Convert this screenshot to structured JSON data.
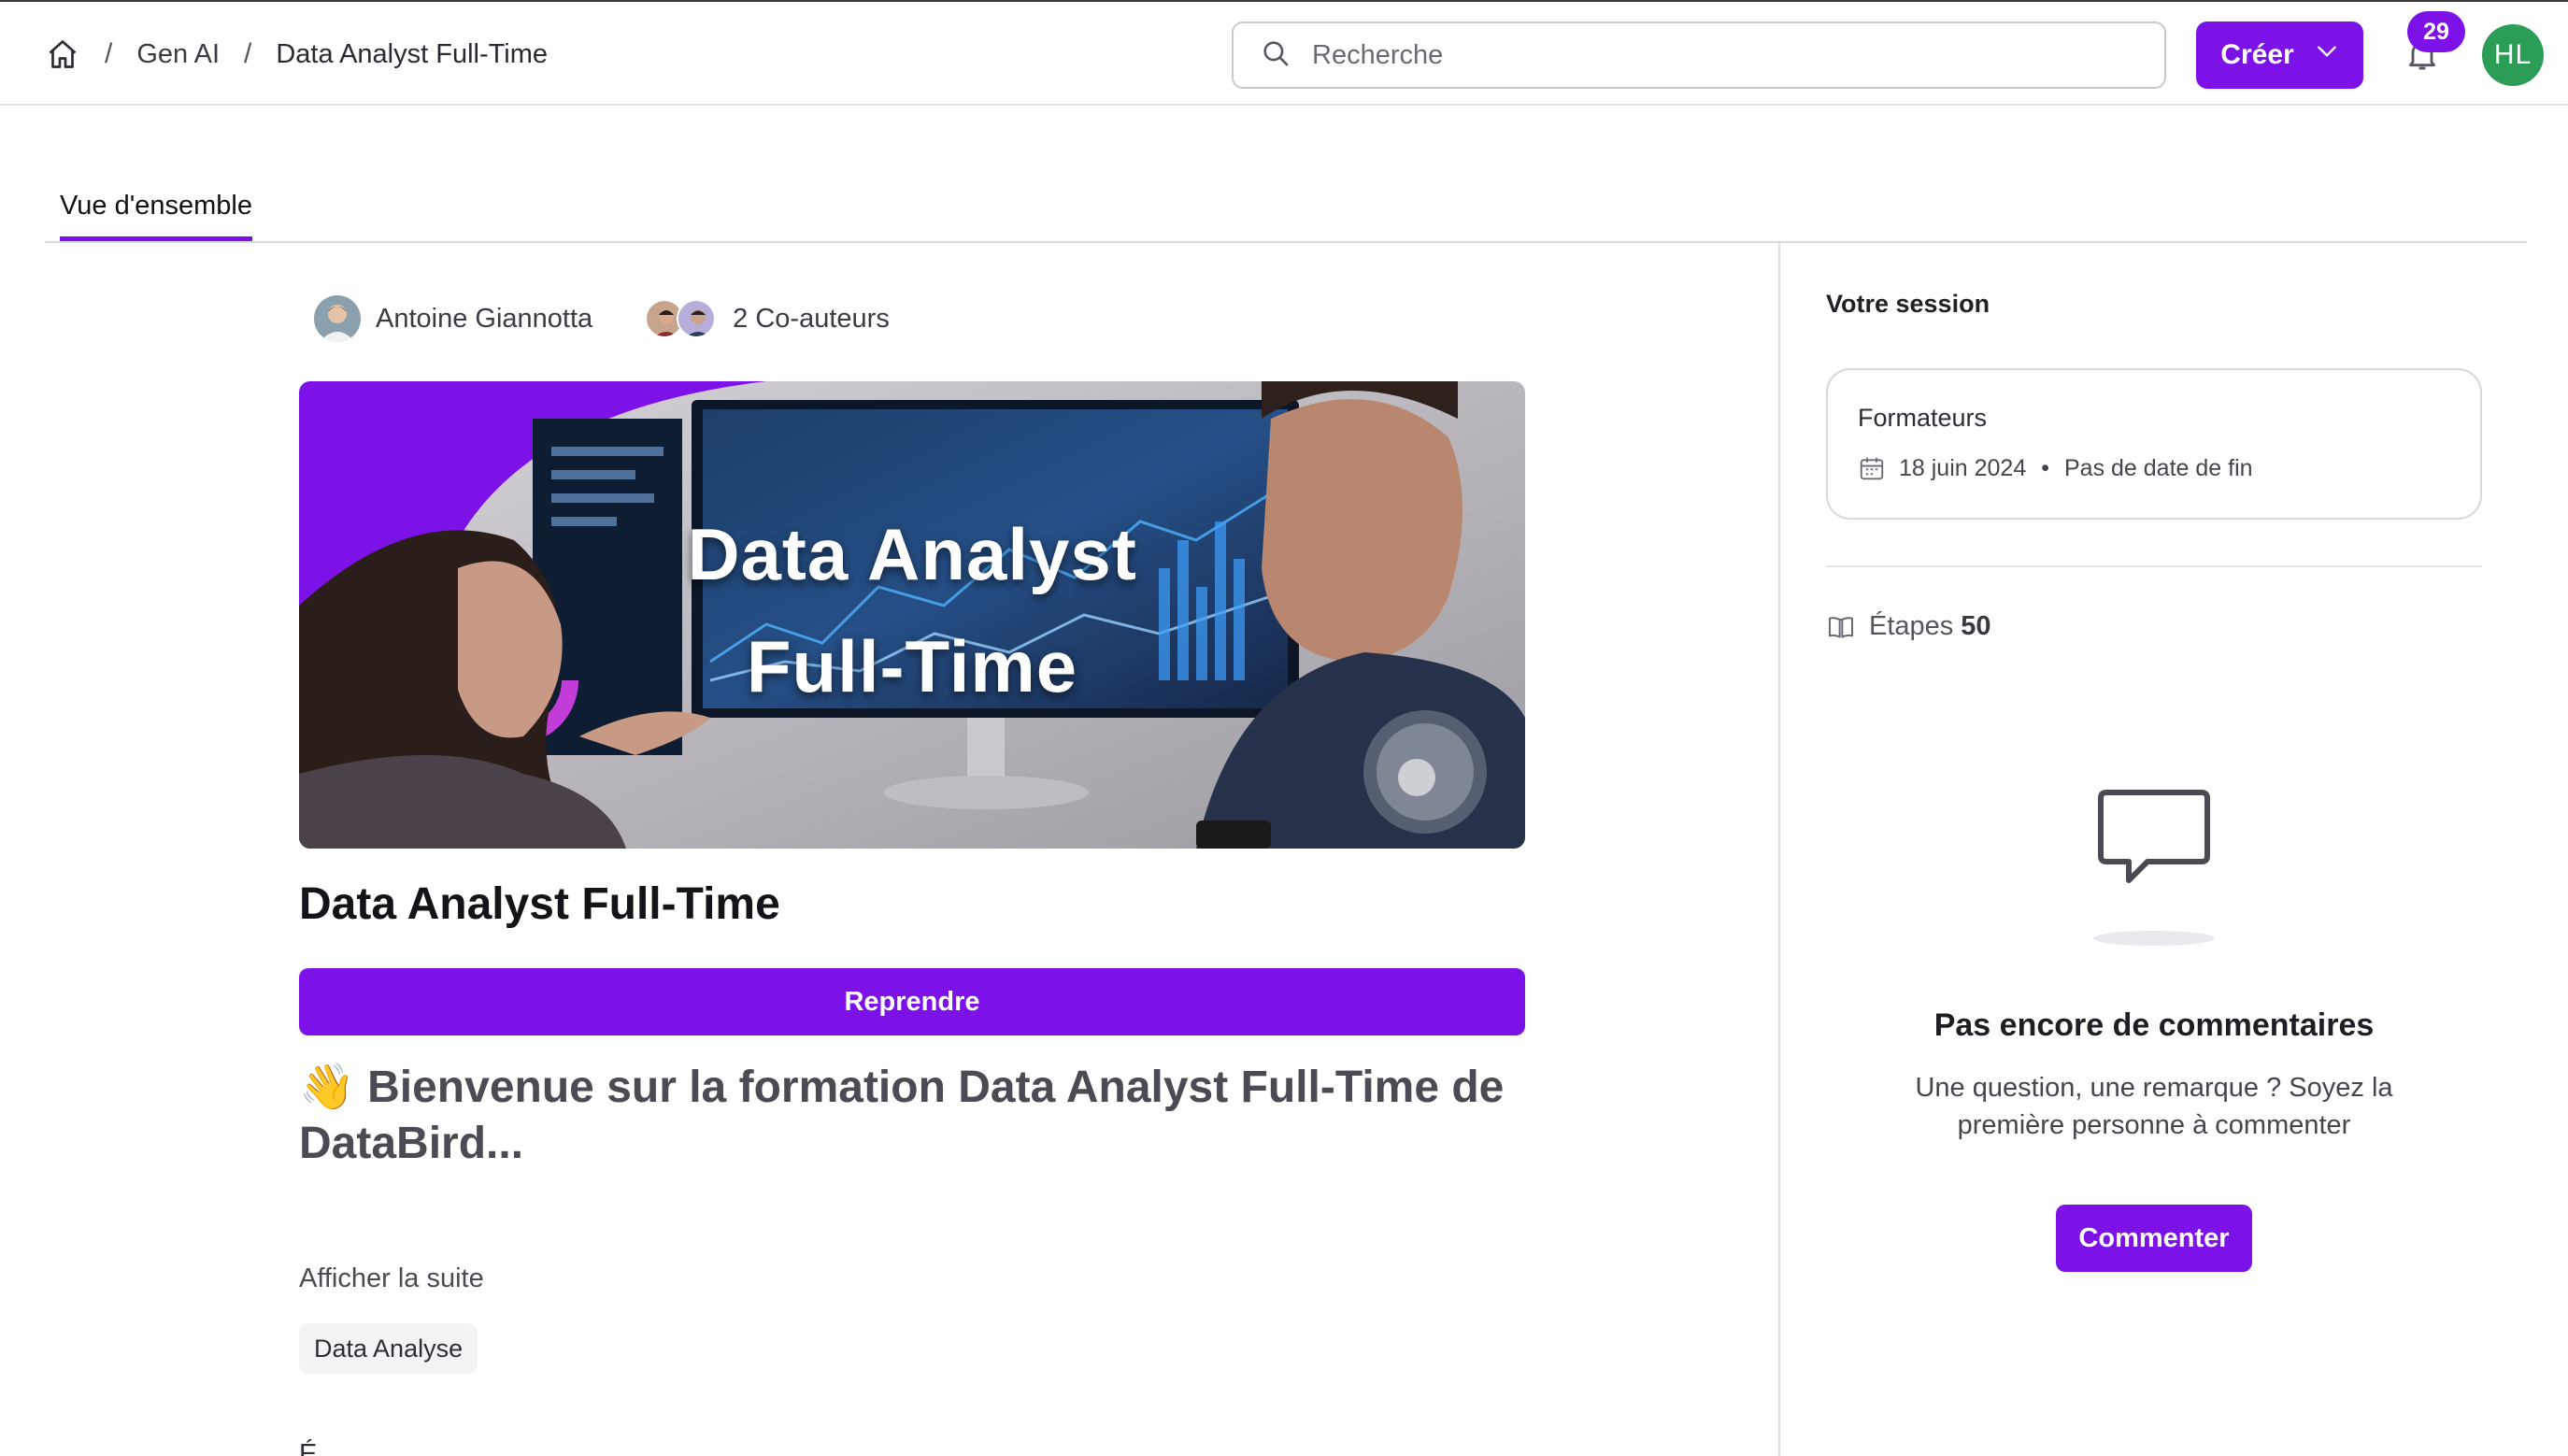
{
  "header": {
    "breadcrumb": [
      "Gen AI",
      "Data Analyst Full-Time"
    ],
    "search_placeholder": "Recherche",
    "create_label": "Créer",
    "notifications_count": "29",
    "user_initials": "HL"
  },
  "tabs": [
    {
      "label": "Vue d'ensemble",
      "active": true
    }
  ],
  "course": {
    "author": "Antoine Giannotta",
    "coauthors_label": "2 Co-auteurs",
    "banner_title_line1": "Data Analyst",
    "banner_title_line2": "Full-Time",
    "title": "Data Analyst Full-Time",
    "resume_label": "Reprendre",
    "description_emoji": "👋",
    "description": "Bienvenue sur la formation Data Analyst Full-Time de DataBird...",
    "show_more_label": "Afficher la suite",
    "tags": [
      "Data Analyse"
    ],
    "truncated_heading": "É"
  },
  "sidebar": {
    "session_label": "Votre session",
    "session_name": "Formateurs",
    "start_date": "18 juin 2024",
    "end_date": "Pas de date de fin",
    "steps_label": "Étapes",
    "steps_count": "50",
    "empty_title": "Pas encore de commentaires",
    "empty_subtitle": "Une question, une remarque ? Soyez la première personne à commenter",
    "comment_label": "Commenter"
  },
  "colors": {
    "accent": "#7c12e8",
    "avatar_green": "#2c9d57",
    "border": "#d7d7dc"
  },
  "icons": [
    "home-icon",
    "search-icon",
    "chevron-down-icon",
    "bell-icon",
    "calendar-icon",
    "book-icon",
    "comment-bubble-icon"
  ]
}
